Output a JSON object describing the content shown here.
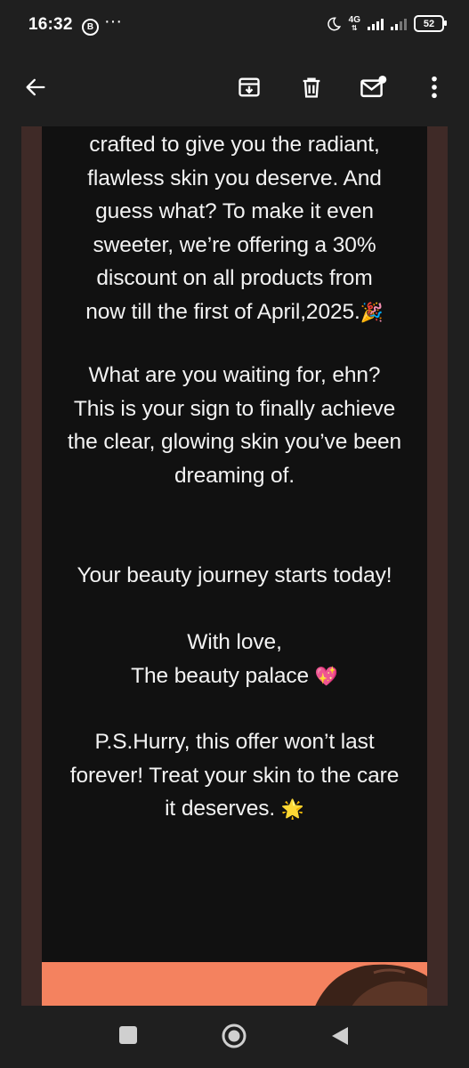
{
  "status_bar": {
    "time": "16:32",
    "notification_badge": "B",
    "more_dots": "···",
    "network_label": "4G",
    "battery": "52"
  },
  "email": {
    "paragraph1": [
      "crafted to give you the radiant,",
      "flawless skin you deserve. And",
      "guess what? To make it even",
      "sweeter, we’re offering a 30%",
      "discount on all products  from",
      "now till  the first of April,2025."
    ],
    "party_emoji": "🎉",
    "paragraph2": [
      "What are you waiting for, ehn?",
      "This is your sign to finally achieve",
      "the clear, glowing skin you’ve been",
      "dreaming of."
    ],
    "tagline": "Your beauty journey starts today!",
    "closing": "With love,",
    "signature": "The beauty palace",
    "heart_emoji": "💖",
    "ps_lines": [
      "P.S.Hurry, this offer won’t last",
      "forever! Treat your skin to the care",
      "it deserves."
    ],
    "star_emoji": "🌟"
  },
  "colors": {
    "background": "#1f1f1f",
    "card": "#111111",
    "border_brown": "#3f2a27",
    "promo_orange": "#f4825f"
  },
  "icons": {
    "back": "back-arrow-icon",
    "archive": "archive-icon",
    "delete": "trash-icon",
    "unread": "mark-unread-icon",
    "more": "more-vert-icon",
    "nav_recent": "recent-apps-icon",
    "nav_home": "home-icon",
    "nav_back": "nav-back-icon"
  }
}
